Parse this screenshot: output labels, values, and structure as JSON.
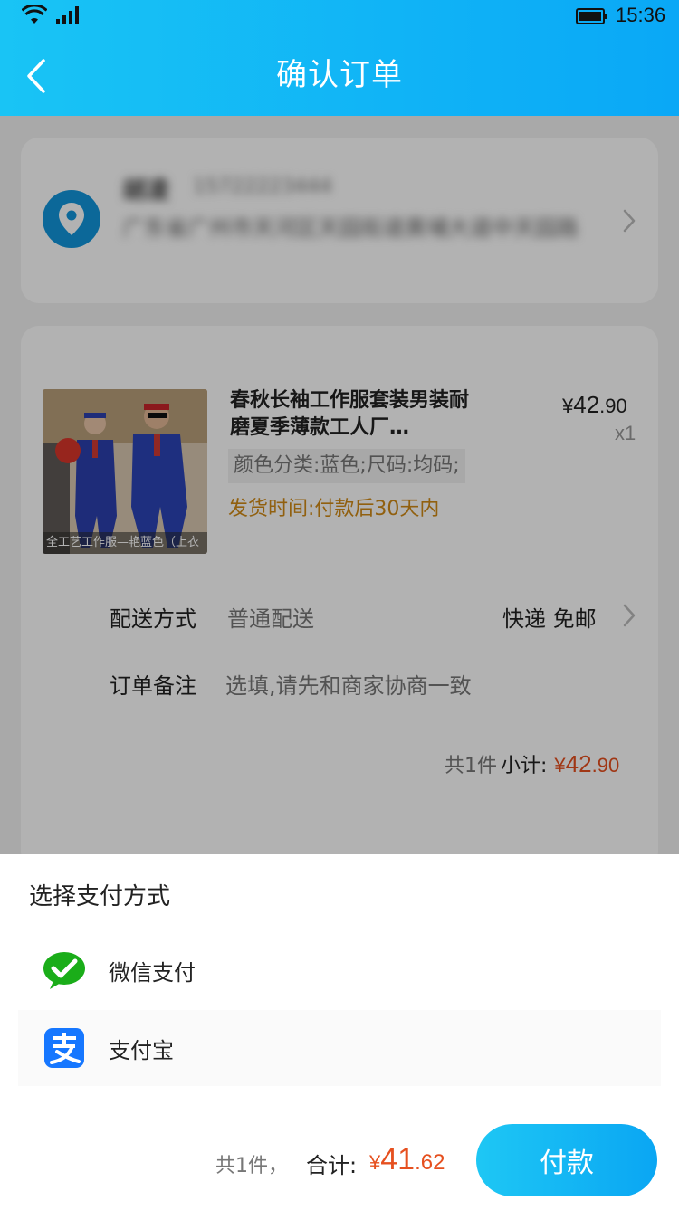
{
  "status_bar": {
    "time": "15:36"
  },
  "header": {
    "title": "确认订单",
    "back_icon": "chevron-left-icon"
  },
  "address": {
    "name": "胡凌",
    "phone": "15722223444",
    "detail": "广东省广州市天河区天园街道黄埔大道中天园路"
  },
  "product": {
    "title_line1": "春秋长袖工作服套装男装耐",
    "title_line2": "磨夏季薄款工人厂…",
    "image_caption": "全工艺工作服—艳蓝色（上衣",
    "price_symbol": "¥",
    "price_int": "42",
    "price_dec": ".90",
    "quantity": "x1",
    "spec": "颜色分类:蓝色;尺码:均码;",
    "shipping_time": "发货时间:付款后30天内"
  },
  "delivery": {
    "label": "配送方式",
    "value": "普通配送",
    "method": "快递 免邮"
  },
  "note": {
    "label": "订单备注",
    "placeholder": "选填,请先和商家协商一致"
  },
  "subtotal": {
    "count": "共1件",
    "label": "小计:",
    "symbol": "¥",
    "int": "42",
    "dec": ".90"
  },
  "payment_sheet": {
    "title": "选择支付方式",
    "options": [
      {
        "label": "微信支付",
        "icon": "wechat-pay-icon"
      },
      {
        "label": "支付宝",
        "icon": "alipay-icon"
      }
    ]
  },
  "footer": {
    "count": "共1件，",
    "total_label": "合计:",
    "symbol": "¥",
    "total_int": "41",
    "total_dec": ".62",
    "pay_button": "付款"
  },
  "colors": {
    "header_start": "#19c4f5",
    "header_end": "#0aa8f6",
    "price_accent": "#e6501f",
    "shipping_text": "#d08a16",
    "wechat_green": "#1aad19",
    "alipay_blue": "#1677ff"
  }
}
